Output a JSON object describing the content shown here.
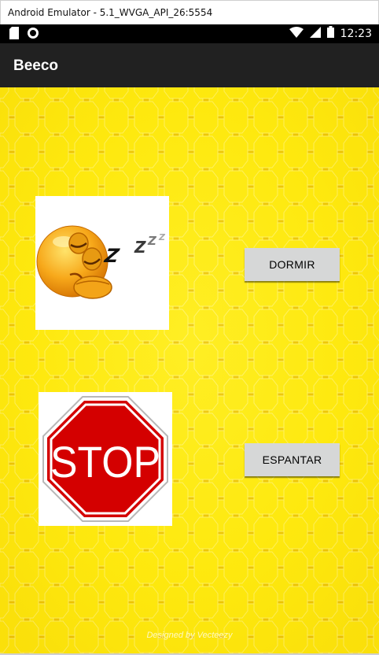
{
  "window": {
    "title": "Android Emulator - 5.1_WVGA_API_26:5554"
  },
  "status_bar": {
    "time": "12:23",
    "icons": [
      "sd-card-icon",
      "record-icon",
      "wifi-icon",
      "signal-icon",
      "battery-icon"
    ]
  },
  "app_bar": {
    "title": "Beeco"
  },
  "main": {
    "sleep_image": {
      "icon": "sleeping-emoji-icon",
      "letters": "ZZZZ"
    },
    "stop_image": {
      "icon": "stop-sign-icon",
      "text": "STOP"
    },
    "buttons": {
      "dormir": "DORMIR",
      "espantar": "ESPANTAR"
    },
    "background_credit": "Designed by Vecteezy"
  },
  "colors": {
    "status_bar": "#000000",
    "app_bar": "#212121",
    "honeycomb": "#f5d800",
    "button": "#d6d7d7",
    "stop_red": "#d40000"
  }
}
